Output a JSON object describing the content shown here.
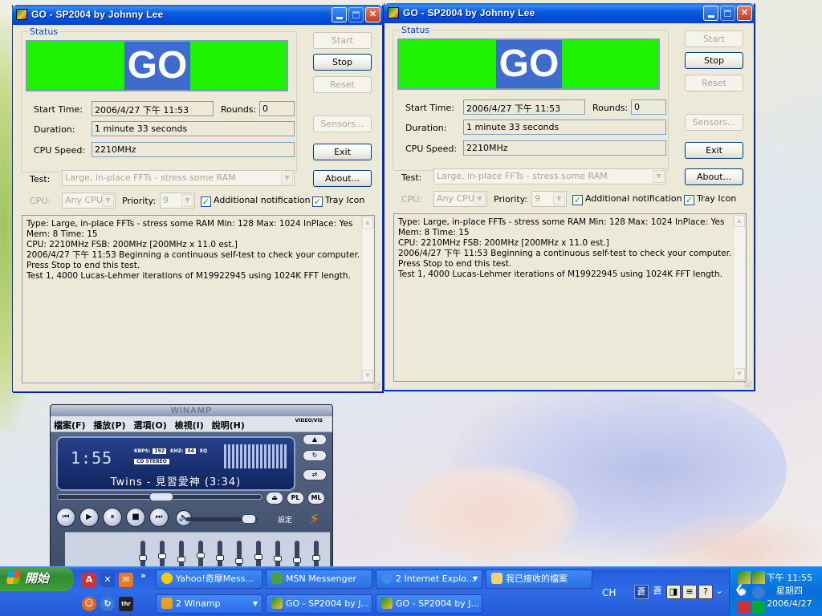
{
  "windows": [
    {
      "title": "GO - SP2004 by Johnny Lee",
      "status_label": "Status",
      "banner_text": "GO",
      "banner_color": "#1ef200",
      "start_time_label": "Start Time:",
      "start_time": "2006/4/27 下午 11:53",
      "rounds_label": "Rounds:",
      "rounds": "0",
      "duration_label": "Duration:",
      "duration": "1 minute 33 seconds",
      "cpu_speed_label": "CPU Speed:",
      "cpu_speed": "2210MHz",
      "buttons": {
        "start": "Start",
        "stop": "Stop",
        "reset": "Reset",
        "sensors": "Sensors...",
        "exit": "Exit",
        "about": "About..."
      },
      "test_label": "Test:",
      "test_value": "Large, in-place FFTs - stress some RAM",
      "cpu_label": "CPU:",
      "cpu_value": "Any CPU",
      "priority_label": "Priority:",
      "priority_value": "9",
      "additional_notification": "Additional notification",
      "tray_icon": "Tray Icon",
      "log": [
        "Type: Large, in-place FFTs - stress some RAM Min: 128 Max: 1024 InPlace: Yes",
        "Mem: 8 Time: 15",
        "CPU: 2210MHz FSB: 200MHz [200MHz x 11.0 est.]",
        "2006/4/27 下午 11:53 Beginning a continuous self-test to check your computer.",
        "Press Stop to end this test.",
        "Test 1, 4000 Lucas-Lehmer iterations of M19922945 using 1024K FFT length."
      ]
    },
    {
      "title": "GO - SP2004 by Johnny Lee",
      "status_label": "Status",
      "banner_text": "GO",
      "banner_color": "#1ef200",
      "start_time_label": "Start Time:",
      "start_time": "2006/4/27 下午 11:53",
      "rounds_label": "Rounds:",
      "rounds": "0",
      "duration_label": "Duration:",
      "duration": "1 minute 33 seconds",
      "cpu_speed_label": "CPU Speed:",
      "cpu_speed": "2210MHz",
      "buttons": {
        "start": "Start",
        "stop": "Stop",
        "reset": "Reset",
        "sensors": "Sensors...",
        "exit": "Exit",
        "about": "About..."
      },
      "test_label": "Test:",
      "test_value": "Large, in-place FFTs - stress some RAM",
      "cpu_label": "CPU:",
      "cpu_value": "Any CPU",
      "priority_label": "Priority:",
      "priority_value": "9",
      "additional_notification": "Additional notification",
      "tray_icon": "Tray Icon",
      "log": [
        "Type: Large, in-place FFTs - stress some RAM Min: 128 Max: 1024 InPlace: Yes",
        "Mem: 8 Time: 15",
        "CPU: 2210MHz FSB: 200MHz [200MHz x 11.0 est.]",
        "2006/4/27 下午 11:53 Beginning a continuous self-test to check your computer.",
        "Press Stop to end this test.",
        "Test 1, 4000 Lucas-Lehmer iterations of M19922945 using 1024K FFT length."
      ]
    }
  ],
  "winamp": {
    "title": "WINAMP",
    "menu": [
      "檔案(F)",
      "播放(P)",
      "選項(O)",
      "檢視(I)",
      "說明(H)"
    ],
    "video_vis": "VIDEO/VIS",
    "time": "1:55",
    "kbps_label": "KBPS:",
    "kbps": "192",
    "khz_label": "KHZ:",
    "khz": "44",
    "eq_label": "EQ",
    "stereo": "CD STEREO",
    "song": "Twins - 見習愛神 (3:34)",
    "pl": "PL",
    "ml": "ML",
    "settings": "設定"
  },
  "taskbar": {
    "start_label": "開始",
    "tasks_row1": [
      {
        "label": "Yahoo!奇摩Mess...",
        "icon": "yahoo-smiley-icon"
      },
      {
        "label": "MSN Messenger",
        "icon": "msn-icon"
      },
      {
        "label": "2 Internet Explo...",
        "icon": "ie-icon"
      },
      {
        "label": "我已接收的檔案",
        "icon": "folder-icon"
      }
    ],
    "tasks_row2": [
      {
        "label": "2 Winamp",
        "icon": "winamp-icon"
      },
      {
        "label": "GO - SP2004 by J...",
        "icon": "sp2004-icon"
      },
      {
        "label": "GO - SP2004 by J...",
        "icon": "sp2004-icon"
      }
    ],
    "lang": "CH",
    "ime1": "蒼",
    "ime2": "蒼",
    "clock_time": "下午 11:55",
    "clock_day": "星期四",
    "clock_date": "2006/4/27"
  }
}
